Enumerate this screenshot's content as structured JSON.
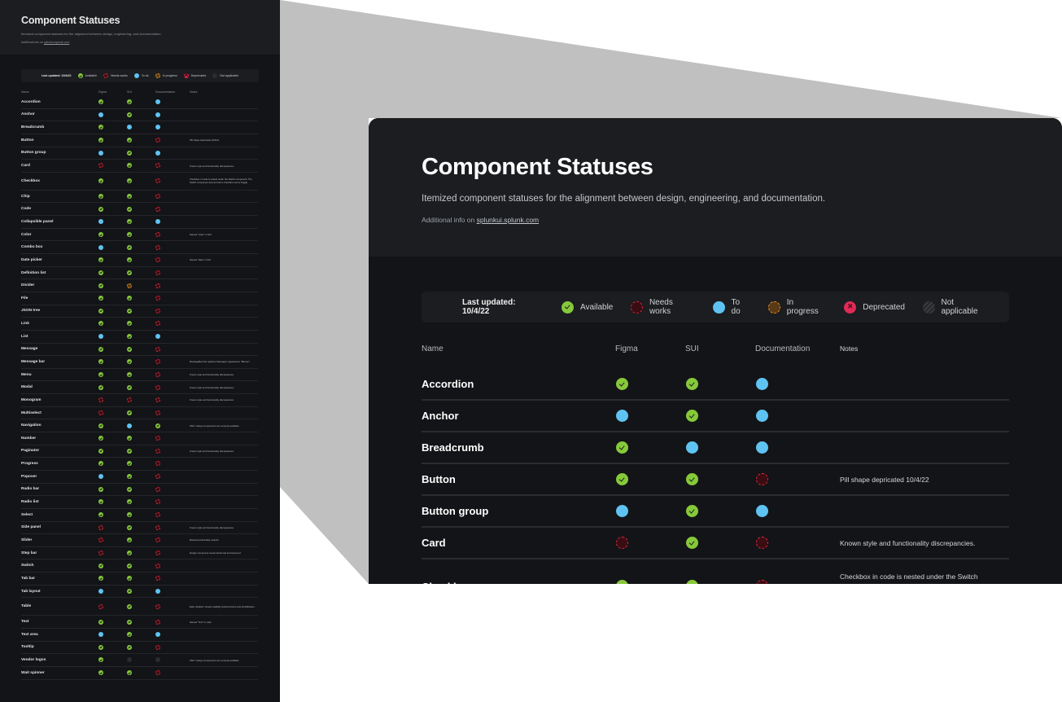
{
  "page": {
    "title": "Component Statuses",
    "subtitle": "Itemized component statuses for the alignment between design, engineering, and documentation.",
    "info_prefix": "Additional info on",
    "info_link": "splunkui.splunk.com"
  },
  "legend": {
    "last_updated": "Last updated: 10/4/22",
    "items": [
      {
        "status": "available",
        "label": "Available"
      },
      {
        "status": "needs",
        "label": "Needs works"
      },
      {
        "status": "todo",
        "label": "To do"
      },
      {
        "status": "progress",
        "label": "In progress"
      },
      {
        "status": "deprecated",
        "label": "Deprecated"
      },
      {
        "status": "na",
        "label": "Not applicable"
      }
    ]
  },
  "status_colors": {
    "available": "#86c93a",
    "needs": "#d7293f",
    "todo": "#5fc3f2",
    "progress": "#e98c24",
    "deprecated": "#df2b56",
    "na": "#3a3c40"
  },
  "table": {
    "columns": [
      "Name",
      "Figma",
      "SUI",
      "Documentation",
      "Notes"
    ],
    "rows": [
      {
        "name": "Accordion",
        "figma": "available",
        "sui": "available",
        "doc": "todo",
        "notes": ""
      },
      {
        "name": "Anchor",
        "figma": "todo",
        "sui": "available",
        "doc": "todo",
        "notes": ""
      },
      {
        "name": "Breadcrumb",
        "figma": "available",
        "sui": "todo",
        "doc": "todo",
        "notes": ""
      },
      {
        "name": "Button",
        "figma": "available",
        "sui": "available",
        "doc": "needs",
        "notes": "Pill shape depricated 10/4/22"
      },
      {
        "name": "Button group",
        "figma": "todo",
        "sui": "available",
        "doc": "todo",
        "notes": ""
      },
      {
        "name": "Card",
        "figma": "needs",
        "sui": "available",
        "doc": "needs",
        "notes": "Known style and functionality discrepancies."
      },
      {
        "name": "Checkbox",
        "figma": "available",
        "sui": "available",
        "doc": "needs",
        "notes": "Checkbox in code is nested under the Switch component. The Switch component acts as both a Checbkox and a Toggle."
      },
      {
        "name": "Chip",
        "figma": "available",
        "sui": "available",
        "doc": "needs",
        "notes": ""
      },
      {
        "name": "Code",
        "figma": "available",
        "sui": "available",
        "doc": "needs",
        "notes": ""
      },
      {
        "name": "Collapsible panel",
        "figma": "todo",
        "sui": "available",
        "doc": "todo",
        "notes": ""
      },
      {
        "name": "Color",
        "figma": "available",
        "sui": "available",
        "doc": "needs",
        "notes": "Named \"Color\" in SUI"
      },
      {
        "name": "Combo box",
        "figma": "todo",
        "sui": "available",
        "doc": "needs",
        "notes": ""
      },
      {
        "name": "Date picker",
        "figma": "available",
        "sui": "available",
        "doc": "needs",
        "notes": "Named \"Date\" in SUI"
      },
      {
        "name": "Definition list",
        "figma": "available",
        "sui": "available",
        "doc": "needs",
        "notes": ""
      },
      {
        "name": "Divider",
        "figma": "available",
        "sui": "progress",
        "doc": "needs",
        "notes": ""
      },
      {
        "name": "File",
        "figma": "available",
        "sui": "available",
        "doc": "needs",
        "notes": ""
      },
      {
        "name": "JSON tree",
        "figma": "available",
        "sui": "available",
        "doc": "needs",
        "notes": ""
      },
      {
        "name": "Link",
        "figma": "available",
        "sui": "available",
        "doc": "needs",
        "notes": ""
      },
      {
        "name": "List",
        "figma": "todo",
        "sui": "available",
        "doc": "todo",
        "notes": ""
      },
      {
        "name": "Message",
        "figma": "available",
        "sui": "available",
        "doc": "needs",
        "notes": ""
      },
      {
        "name": "Message bar",
        "figma": "available",
        "sui": "available",
        "doc": "needs",
        "notes": "MessageBar that replaces Message's appearance \"Banner\"."
      },
      {
        "name": "Menu",
        "figma": "available",
        "sui": "available",
        "doc": "needs",
        "notes": "Known style and functionality discrepancies."
      },
      {
        "name": "Modal",
        "figma": "available",
        "sui": "available",
        "doc": "needs",
        "notes": "Known style and functionality discrepancies."
      },
      {
        "name": "Monogram",
        "figma": "needs",
        "sui": "needs",
        "doc": "needs",
        "notes": "Known style and functionality discrepancies."
      },
      {
        "name": "Multiselect",
        "figma": "needs",
        "sui": "available",
        "doc": "needs",
        "notes": ""
      },
      {
        "name": "Navigation",
        "figma": "available",
        "sui": "todo",
        "doc": "available",
        "notes": "ONLY design components are currently available"
      },
      {
        "name": "Number",
        "figma": "available",
        "sui": "available",
        "doc": "needs",
        "notes": ""
      },
      {
        "name": "Paginator",
        "figma": "available",
        "sui": "available",
        "doc": "needs",
        "notes": "Known style and functionality discrepancies."
      },
      {
        "name": "Progress",
        "figma": "available",
        "sui": "available",
        "doc": "needs",
        "notes": ""
      },
      {
        "name": "Popover",
        "figma": "todo",
        "sui": "available",
        "doc": "needs",
        "notes": ""
      },
      {
        "name": "Radio bar",
        "figma": "available",
        "sui": "available",
        "doc": "needs",
        "notes": ""
      },
      {
        "name": "Radio list",
        "figma": "available",
        "sui": "available",
        "doc": "needs",
        "notes": ""
      },
      {
        "name": "Select",
        "figma": "available",
        "sui": "available",
        "doc": "needs",
        "notes": ""
      },
      {
        "name": "Side panel",
        "figma": "needs",
        "sui": "available",
        "doc": "needs",
        "notes": "Known style and functionality discrepancies."
      },
      {
        "name": "Slider",
        "figma": "needs",
        "sui": "available",
        "doc": "needs",
        "notes": "Missing functionality variants"
      },
      {
        "name": "Step bar",
        "figma": "needs",
        "sui": "available",
        "doc": "needs",
        "notes": "Design component needs structured and improved"
      },
      {
        "name": "Switch",
        "figma": "available",
        "sui": "available",
        "doc": "needs",
        "notes": ""
      },
      {
        "name": "Tab bar",
        "figma": "available",
        "sui": "available",
        "doc": "needs",
        "notes": ""
      },
      {
        "name": "Tab layout",
        "figma": "todo",
        "sui": "available",
        "doc": "todo",
        "notes": ""
      },
      {
        "name": "Table",
        "figma": "needs",
        "sui": "available",
        "doc": "needs",
        "notes": "Early variation. Needs usability enhancements and simplification."
      },
      {
        "name": "Text",
        "figma": "available",
        "sui": "available",
        "doc": "needs",
        "notes": "Named \"Text\" in code"
      },
      {
        "name": "Text area",
        "figma": "todo",
        "sui": "available",
        "doc": "todo",
        "notes": ""
      },
      {
        "name": "Tooltip",
        "figma": "available",
        "sui": "available",
        "doc": "needs",
        "notes": ""
      },
      {
        "name": "Vendor logos",
        "figma": "available",
        "sui": "na",
        "doc": "na",
        "notes": "ONLY design components are currently available"
      },
      {
        "name": "Wait spinner",
        "figma": "available",
        "sui": "available",
        "doc": "needs",
        "notes": ""
      }
    ]
  },
  "zoom_view": {
    "visible_rows": 7
  }
}
